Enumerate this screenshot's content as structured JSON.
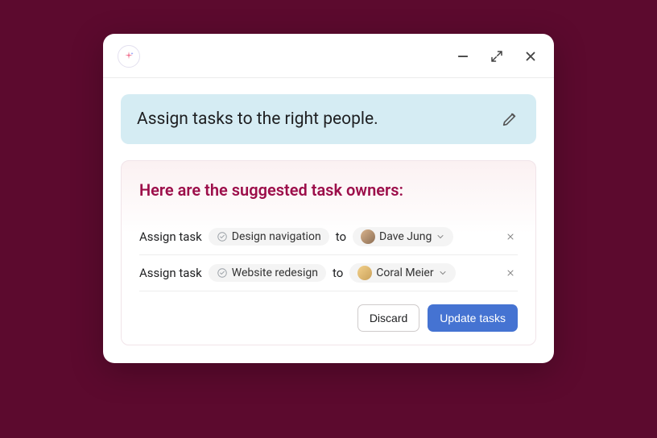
{
  "prompt": {
    "text": "Assign tasks to the right people."
  },
  "suggestions": {
    "title": "Here are the suggested task owners:",
    "rows": [
      {
        "prefix": "Assign task",
        "task_name": "Design navigation",
        "connector": "to",
        "assignee": "Dave Jung"
      },
      {
        "prefix": "Assign task",
        "task_name": "Website redesign",
        "connector": "to",
        "assignee": "Coral Meier"
      }
    ]
  },
  "actions": {
    "discard": "Discard",
    "update": "Update tasks"
  }
}
